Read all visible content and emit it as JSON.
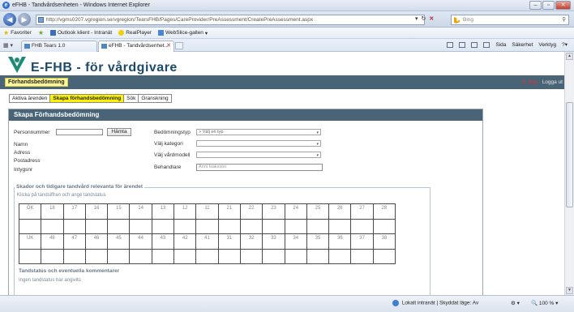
{
  "window": {
    "title": "eFHB - Tandvårdsenheten - Windows Internet Explorer",
    "address_url": "http://vgms0207.vgregion.se/vgregion/TearsFHB/Pages/CareProvider/PreAssessment/CreatePreAssessment.aspx",
    "search_placeholder": "Bing"
  },
  "favorites_bar": {
    "favorites_label": "Favoriter",
    "items": [
      "Outlook klient - Intranät",
      "RealPlayer",
      "WebSlice-gallen"
    ]
  },
  "browser_tabs": [
    {
      "label": "FHB Tears 1.0"
    },
    {
      "label": "eFHB - Tandvårdsenhet..."
    }
  ],
  "command_bar": {
    "page": "Sida",
    "safety": "Säkerhet",
    "tools": "Verktyg"
  },
  "app": {
    "title": "E-FHB - för vårdgivare",
    "breadcrumb": "Förhandsbedömning",
    "user_name": "S. Bay",
    "logout_label": "Logga ut",
    "tabs": [
      "Aktiva ärenden",
      "Skapa förhandsbedömning",
      "Sök",
      "Granskning"
    ],
    "active_tab_index": 1
  },
  "form": {
    "panel_title": "Skapa Förhandsbedömning",
    "personnummer_label": "Personnummer",
    "hamta_button": "Hämta",
    "namn_label": "Namn",
    "adress_label": "Adress",
    "postadress_label": "Postadress",
    "intygsnr_label": "Intygsnr",
    "bedomningstyp_label": "Bedömningstyp",
    "bedomningstyp_value": "> Välj en typ",
    "kategori_label": "Välj kategori",
    "kategori_value": "",
    "vardmodell_label": "Välj vårdmodell",
    "vardmodell_value": "",
    "behandlare_label": "Behandlare",
    "behandlare_placeholder": "Anni Isaksson"
  },
  "teeth": {
    "legend": "Skador och tidigare tandvård relevanta för ärendet",
    "hint": "Klicka på tandsiffran och ange tandstatus",
    "upper": [
      "ÖK",
      "18",
      "17",
      "16",
      "15",
      "14",
      "13",
      "12",
      "11",
      "21",
      "22",
      "23",
      "24",
      "25",
      "26",
      "27",
      "28"
    ],
    "lower": [
      "UK",
      "48",
      "47",
      "46",
      "45",
      "44",
      "43",
      "42",
      "41",
      "31",
      "32",
      "33",
      "34",
      "35",
      "36",
      "37",
      "38"
    ]
  },
  "comments": {
    "title": "Tandstatus och eventuella kommentarer",
    "placeholder": "Ingen tandstatus har angivits"
  },
  "statusbar": {
    "zone": "Lokalt intranät | Skyddat läge: Av",
    "zoom": "100 %"
  }
}
